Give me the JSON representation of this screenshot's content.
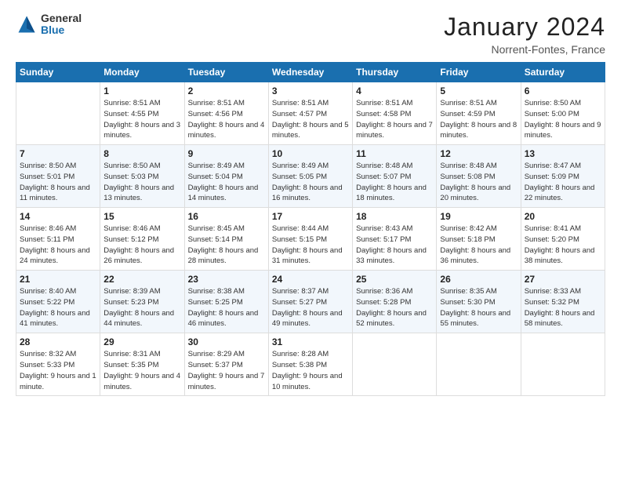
{
  "logo": {
    "general": "General",
    "blue": "Blue"
  },
  "title": "January 2024",
  "location": "Norrent-Fontes, France",
  "days_of_week": [
    "Sunday",
    "Monday",
    "Tuesday",
    "Wednesday",
    "Thursday",
    "Friday",
    "Saturday"
  ],
  "weeks": [
    [
      {
        "day": "",
        "sunrise": "",
        "sunset": "",
        "daylight": ""
      },
      {
        "day": "1",
        "sunrise": "Sunrise: 8:51 AM",
        "sunset": "Sunset: 4:55 PM",
        "daylight": "Daylight: 8 hours and 3 minutes."
      },
      {
        "day": "2",
        "sunrise": "Sunrise: 8:51 AM",
        "sunset": "Sunset: 4:56 PM",
        "daylight": "Daylight: 8 hours and 4 minutes."
      },
      {
        "day": "3",
        "sunrise": "Sunrise: 8:51 AM",
        "sunset": "Sunset: 4:57 PM",
        "daylight": "Daylight: 8 hours and 5 minutes."
      },
      {
        "day": "4",
        "sunrise": "Sunrise: 8:51 AM",
        "sunset": "Sunset: 4:58 PM",
        "daylight": "Daylight: 8 hours and 7 minutes."
      },
      {
        "day": "5",
        "sunrise": "Sunrise: 8:51 AM",
        "sunset": "Sunset: 4:59 PM",
        "daylight": "Daylight: 8 hours and 8 minutes."
      },
      {
        "day": "6",
        "sunrise": "Sunrise: 8:50 AM",
        "sunset": "Sunset: 5:00 PM",
        "daylight": "Daylight: 8 hours and 9 minutes."
      }
    ],
    [
      {
        "day": "7",
        "sunrise": "Sunrise: 8:50 AM",
        "sunset": "Sunset: 5:01 PM",
        "daylight": "Daylight: 8 hours and 11 minutes."
      },
      {
        "day": "8",
        "sunrise": "Sunrise: 8:50 AM",
        "sunset": "Sunset: 5:03 PM",
        "daylight": "Daylight: 8 hours and 13 minutes."
      },
      {
        "day": "9",
        "sunrise": "Sunrise: 8:49 AM",
        "sunset": "Sunset: 5:04 PM",
        "daylight": "Daylight: 8 hours and 14 minutes."
      },
      {
        "day": "10",
        "sunrise": "Sunrise: 8:49 AM",
        "sunset": "Sunset: 5:05 PM",
        "daylight": "Daylight: 8 hours and 16 minutes."
      },
      {
        "day": "11",
        "sunrise": "Sunrise: 8:48 AM",
        "sunset": "Sunset: 5:07 PM",
        "daylight": "Daylight: 8 hours and 18 minutes."
      },
      {
        "day": "12",
        "sunrise": "Sunrise: 8:48 AM",
        "sunset": "Sunset: 5:08 PM",
        "daylight": "Daylight: 8 hours and 20 minutes."
      },
      {
        "day": "13",
        "sunrise": "Sunrise: 8:47 AM",
        "sunset": "Sunset: 5:09 PM",
        "daylight": "Daylight: 8 hours and 22 minutes."
      }
    ],
    [
      {
        "day": "14",
        "sunrise": "Sunrise: 8:46 AM",
        "sunset": "Sunset: 5:11 PM",
        "daylight": "Daylight: 8 hours and 24 minutes."
      },
      {
        "day": "15",
        "sunrise": "Sunrise: 8:46 AM",
        "sunset": "Sunset: 5:12 PM",
        "daylight": "Daylight: 8 hours and 26 minutes."
      },
      {
        "day": "16",
        "sunrise": "Sunrise: 8:45 AM",
        "sunset": "Sunset: 5:14 PM",
        "daylight": "Daylight: 8 hours and 28 minutes."
      },
      {
        "day": "17",
        "sunrise": "Sunrise: 8:44 AM",
        "sunset": "Sunset: 5:15 PM",
        "daylight": "Daylight: 8 hours and 31 minutes."
      },
      {
        "day": "18",
        "sunrise": "Sunrise: 8:43 AM",
        "sunset": "Sunset: 5:17 PM",
        "daylight": "Daylight: 8 hours and 33 minutes."
      },
      {
        "day": "19",
        "sunrise": "Sunrise: 8:42 AM",
        "sunset": "Sunset: 5:18 PM",
        "daylight": "Daylight: 8 hours and 36 minutes."
      },
      {
        "day": "20",
        "sunrise": "Sunrise: 8:41 AM",
        "sunset": "Sunset: 5:20 PM",
        "daylight": "Daylight: 8 hours and 38 minutes."
      }
    ],
    [
      {
        "day": "21",
        "sunrise": "Sunrise: 8:40 AM",
        "sunset": "Sunset: 5:22 PM",
        "daylight": "Daylight: 8 hours and 41 minutes."
      },
      {
        "day": "22",
        "sunrise": "Sunrise: 8:39 AM",
        "sunset": "Sunset: 5:23 PM",
        "daylight": "Daylight: 8 hours and 44 minutes."
      },
      {
        "day": "23",
        "sunrise": "Sunrise: 8:38 AM",
        "sunset": "Sunset: 5:25 PM",
        "daylight": "Daylight: 8 hours and 46 minutes."
      },
      {
        "day": "24",
        "sunrise": "Sunrise: 8:37 AM",
        "sunset": "Sunset: 5:27 PM",
        "daylight": "Daylight: 8 hours and 49 minutes."
      },
      {
        "day": "25",
        "sunrise": "Sunrise: 8:36 AM",
        "sunset": "Sunset: 5:28 PM",
        "daylight": "Daylight: 8 hours and 52 minutes."
      },
      {
        "day": "26",
        "sunrise": "Sunrise: 8:35 AM",
        "sunset": "Sunset: 5:30 PM",
        "daylight": "Daylight: 8 hours and 55 minutes."
      },
      {
        "day": "27",
        "sunrise": "Sunrise: 8:33 AM",
        "sunset": "Sunset: 5:32 PM",
        "daylight": "Daylight: 8 hours and 58 minutes."
      }
    ],
    [
      {
        "day": "28",
        "sunrise": "Sunrise: 8:32 AM",
        "sunset": "Sunset: 5:33 PM",
        "daylight": "Daylight: 9 hours and 1 minute."
      },
      {
        "day": "29",
        "sunrise": "Sunrise: 8:31 AM",
        "sunset": "Sunset: 5:35 PM",
        "daylight": "Daylight: 9 hours and 4 minutes."
      },
      {
        "day": "30",
        "sunrise": "Sunrise: 8:29 AM",
        "sunset": "Sunset: 5:37 PM",
        "daylight": "Daylight: 9 hours and 7 minutes."
      },
      {
        "day": "31",
        "sunrise": "Sunrise: 8:28 AM",
        "sunset": "Sunset: 5:38 PM",
        "daylight": "Daylight: 9 hours and 10 minutes."
      },
      {
        "day": "",
        "sunrise": "",
        "sunset": "",
        "daylight": ""
      },
      {
        "day": "",
        "sunrise": "",
        "sunset": "",
        "daylight": ""
      },
      {
        "day": "",
        "sunrise": "",
        "sunset": "",
        "daylight": ""
      }
    ]
  ]
}
